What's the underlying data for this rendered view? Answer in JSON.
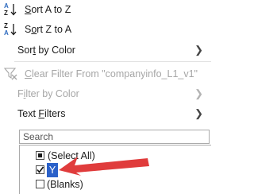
{
  "menu": {
    "sort_az": {
      "pre": "",
      "key": "S",
      "post": "ort A to Z"
    },
    "sort_za": {
      "pre": "S",
      "key": "o",
      "post": "rt Z to A"
    },
    "sort_by_color": {
      "pre": "Sor",
      "key": "t",
      "post": " by Color"
    },
    "clear_filter": {
      "key": "C",
      "post": "lear Filter From \"companyinfo_L1_v1\""
    },
    "filter_by_color": {
      "pre": "F",
      "key": "i",
      "post": "lter by Color"
    },
    "text_filters": {
      "pre": "Text ",
      "key": "F",
      "post": "ilters"
    }
  },
  "search": {
    "placeholder": "Search"
  },
  "list": [
    {
      "label": "(Select All)",
      "state": "partial"
    },
    {
      "label": "Y",
      "state": "checked"
    },
    {
      "label": "(Blanks)",
      "state": "unchecked"
    }
  ],
  "colors": {
    "arrow": "#e03c3c",
    "highlight": "#2b61c9",
    "sort_icon": "#2e6bbf"
  },
  "icons": {
    "sort_az": "sort-ascending-icon",
    "sort_za": "sort-descending-icon",
    "clear_filter": "clear-filter-icon",
    "submenu": "chevron-right-icon"
  }
}
